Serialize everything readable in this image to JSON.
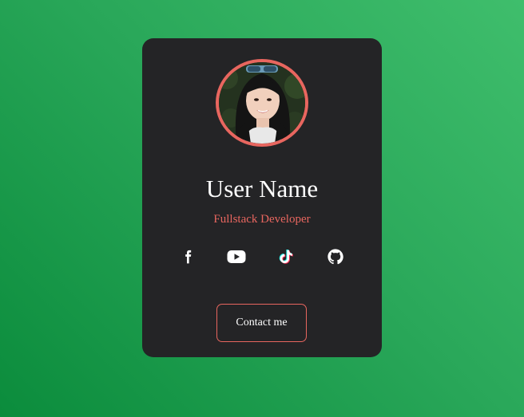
{
  "profile": {
    "name": "User Name",
    "role": "Fullstack Developer",
    "avatar_alt": "avatar"
  },
  "socials": [
    {
      "icon": "facebook-icon"
    },
    {
      "icon": "youtube-icon"
    },
    {
      "icon": "tiktok-icon"
    },
    {
      "icon": "github-icon"
    }
  ],
  "contact": {
    "label": "Contact me"
  },
  "colors": {
    "accent": "#e8665f",
    "card_bg": "#242426",
    "bg_light": "#3fbe6c",
    "bg_dark": "#0b8c3c"
  }
}
